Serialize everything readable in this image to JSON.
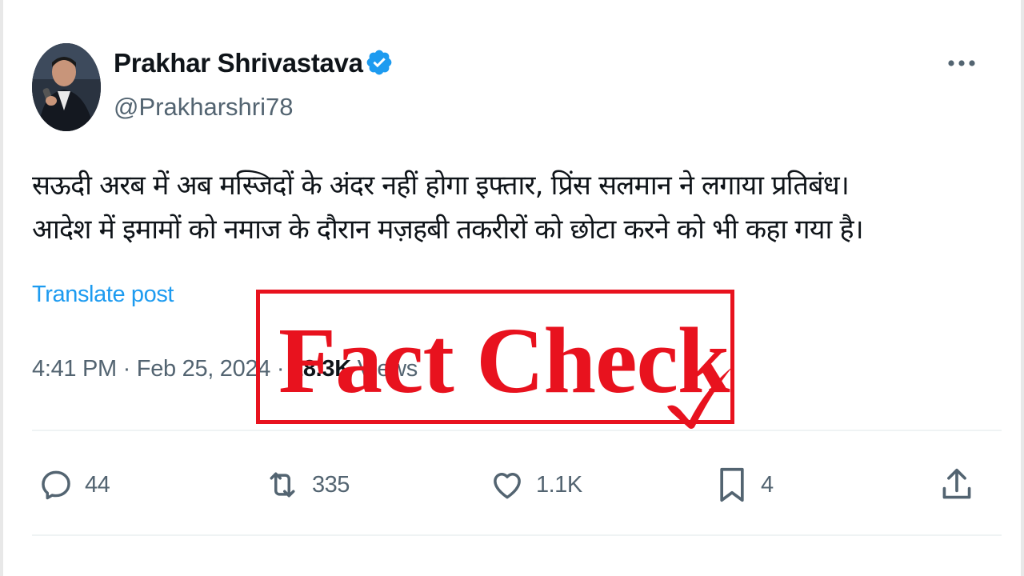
{
  "author": {
    "name": "Prakhar Shrivastava",
    "handle": "@Prakharshri78",
    "verified": true,
    "verified_color": "#1d9bf0"
  },
  "tweet": {
    "lines": [
      "सऊदी अरब में अब मस्जिदों के अंदर नहीं होगा इफ्तार, प्रिंस सलमान ने लगाया प्रतिबंध।",
      "आदेश में इमामों को नमाज के दौरान मज़हबी तकरीरों को छोटा करने को भी कहा गया है।"
    ],
    "translate_label": "Translate post",
    "time": "4:41 PM",
    "separator": "·",
    "date": "Feb 25, 2024",
    "views_count": "18.3K",
    "views_label": "Views"
  },
  "actions": {
    "replies": {
      "icon": "reply-icon",
      "count": "44"
    },
    "reposts": {
      "icon": "repost-icon",
      "count": "335"
    },
    "likes": {
      "icon": "like-icon",
      "count": "1.1K"
    },
    "bookmarks": {
      "icon": "bookmark-icon",
      "count": "4"
    },
    "share": {
      "icon": "share-icon"
    }
  },
  "overlay": {
    "stamp_text": "Fact Check",
    "stamp_color": "#e8121e",
    "check_icon": "checkmark-icon"
  },
  "colors": {
    "text_primary": "#0f1419",
    "text_secondary": "#536471",
    "link": "#1d9bf0",
    "divider": "#eff3f4"
  }
}
